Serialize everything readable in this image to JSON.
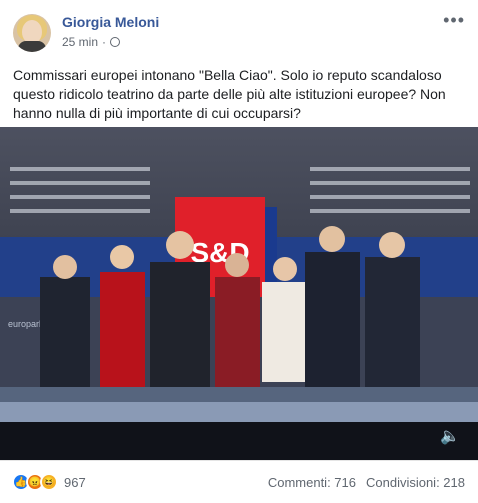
{
  "post": {
    "author": "Giorgia Meloni",
    "time": "25 min",
    "more_icon": "more-icon",
    "privacy_icon": "globe-icon",
    "text": "Commissari europei intonano \"Bella Ciao\". Solo io reputo scandaloso questo ridicolo teatrino da parte delle più alte istituzioni europee? Non hanno nulla di più importante di cui occuparsi?"
  },
  "video": {
    "banner_text": "S&D",
    "site_label": "europarl.eu",
    "mute_icon": "volume-icon"
  },
  "stats": {
    "reaction_count": "967",
    "comments": "Commenti: 716",
    "shares": "Condivisioni: 218"
  },
  "colors": {
    "name_link": "#385898",
    "like_blue": "#1877f2",
    "banner_red": "#e0202a"
  }
}
